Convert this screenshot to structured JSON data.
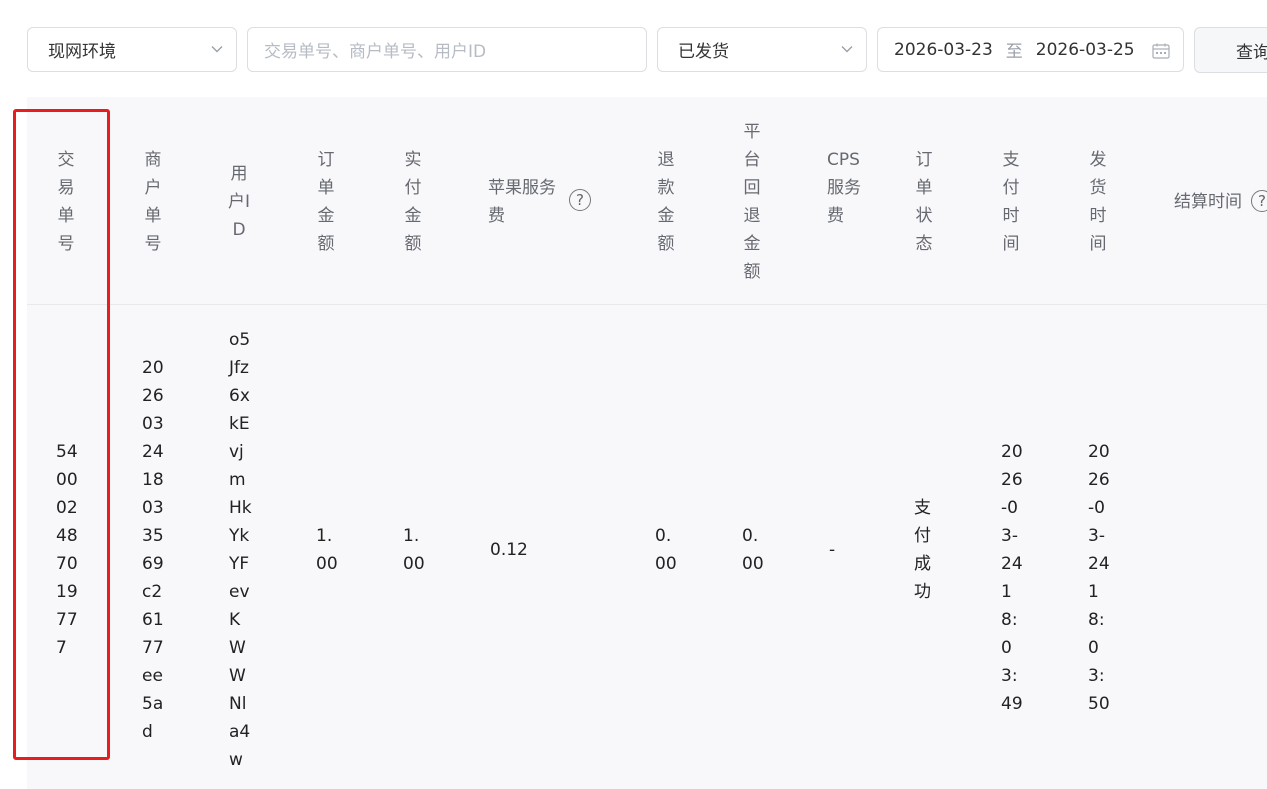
{
  "filters": {
    "environment": "现网环境",
    "search_placeholder": "交易单号、商户单号、用户ID",
    "status": "已发货",
    "date_start": "2026-03-23",
    "date_sep": "至",
    "date_end": "2026-03-25",
    "query_label": "查询"
  },
  "table": {
    "headers": {
      "trade_no": "交易单号",
      "merchant_no": "商户单号",
      "user_id": "用户ID",
      "order_amount": "订单金额",
      "paid_amount": "实付金额",
      "apple_fee": "苹果服务费",
      "refund_amount": "退款金额",
      "platform_refund": "平台回退金额",
      "cps_fee": "CPS服务费",
      "order_status": "订单状态",
      "pay_time": "支付时间",
      "ship_time": "发货时间",
      "settle_time": "结算时间"
    },
    "row": {
      "trade_no": "540002487019777",
      "merchant_no": "2026032418033569c26177ee5ad",
      "user_id": "o5Jfz6xkEvjmHkYkYFevKWWNla4w",
      "order_amount": "1.00",
      "paid_amount": "1.00",
      "apple_fee": "0.12",
      "refund_amount": "0.00",
      "platform_refund": "0.00",
      "cps_fee": "-",
      "order_status": "支付成功",
      "pay_time": "2026-03-24 18:03:49",
      "ship_time": "2026-03-24 18:03:50"
    },
    "help_glyph": "?"
  },
  "colors": {
    "highlight": "#e81d1d",
    "header_bg": "#f8f8fa"
  }
}
